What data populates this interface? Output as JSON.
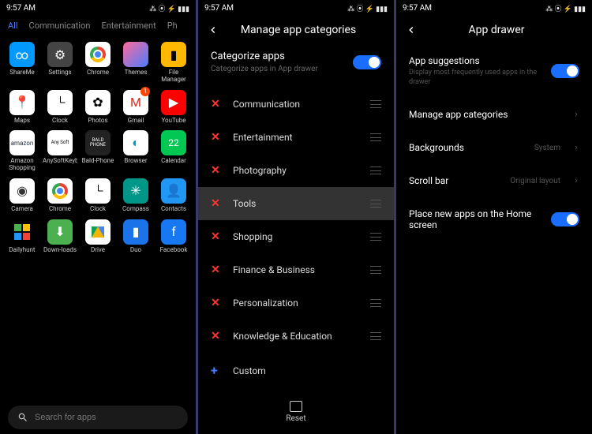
{
  "status": {
    "time": "9:57 AM",
    "icons": "⁂ ⦿ ⚡ ▮▮▮"
  },
  "drawer": {
    "tabs": [
      "All",
      "Communication",
      "Entertainment",
      "Ph"
    ],
    "apps": [
      {
        "label": "ShareMe",
        "icon": "∞",
        "cls": "ic-shareme"
      },
      {
        "label": "Settings",
        "icon": "⚙",
        "cls": "ic-settings"
      },
      {
        "label": "Chrome",
        "icon": "chrome",
        "cls": "ic-chrome"
      },
      {
        "label": "Themes",
        "icon": "",
        "cls": "ic-themes"
      },
      {
        "label": "File Manager",
        "icon": "▮",
        "cls": "ic-filemgr"
      },
      {
        "label": "Maps",
        "icon": "📍",
        "cls": "ic-maps"
      },
      {
        "label": "Clock",
        "icon": "clock",
        "cls": "ic-clock"
      },
      {
        "label": "Photos",
        "icon": "✿",
        "cls": "ic-photos"
      },
      {
        "label": "Gmail",
        "icon": "M",
        "cls": "ic-gmail",
        "badge": "1"
      },
      {
        "label": "YouTube",
        "icon": "▶",
        "cls": "ic-youtube"
      },
      {
        "label": "Amazon Shopping",
        "icon": "amazon",
        "cls": "ic-amazon"
      },
      {
        "label": "AnySoftKeyboa...",
        "icon": "Any Soft",
        "cls": "ic-anysoft"
      },
      {
        "label": "Bald-Phone",
        "icon": "BALD PHONE",
        "cls": "ic-bald"
      },
      {
        "label": "Browser",
        "icon": "◐",
        "cls": "ic-browser"
      },
      {
        "label": "Calendar",
        "icon": "22",
        "cls": "ic-calendar"
      },
      {
        "label": "Camera",
        "icon": "◉",
        "cls": "ic-camera"
      },
      {
        "label": "Chrome",
        "icon": "chrome",
        "cls": "ic-chrome2"
      },
      {
        "label": "Clock",
        "icon": "clock",
        "cls": "ic-clock2"
      },
      {
        "label": "Compass",
        "icon": "✳",
        "cls": "ic-compass"
      },
      {
        "label": "Contacts",
        "icon": "👤",
        "cls": "ic-contacts"
      },
      {
        "label": "Dailyhunt",
        "icon": "dailyhunt",
        "cls": "ic-dailyhunt"
      },
      {
        "label": "Down-loads",
        "icon": "⬇",
        "cls": "ic-downloads"
      },
      {
        "label": "Drive",
        "icon": "drive",
        "cls": "ic-drive"
      },
      {
        "label": "Duo",
        "icon": "▮",
        "cls": "ic-duo"
      },
      {
        "label": "Facebook",
        "icon": "f",
        "cls": "ic-facebook"
      }
    ],
    "search_placeholder": "Search for apps"
  },
  "manage": {
    "title": "Manage app categories",
    "toggle_title": "Categorize apps",
    "toggle_sub": "Categorize apps in App drawer",
    "categories": [
      {
        "name": "Communication",
        "highlighted": false
      },
      {
        "name": "Entertainment",
        "highlighted": false
      },
      {
        "name": "Photography",
        "highlighted": false
      },
      {
        "name": "Tools",
        "highlighted": true
      },
      {
        "name": "Shopping",
        "highlighted": false
      },
      {
        "name": "Finance & Business",
        "highlighted": false
      },
      {
        "name": "Personalization",
        "highlighted": false
      },
      {
        "name": "Knowledge & Education",
        "highlighted": false
      }
    ],
    "custom_label": "Custom",
    "reset_label": "Reset"
  },
  "settings": {
    "title": "App drawer",
    "rows": [
      {
        "title": "App suggestions",
        "sub": "Display most frequently used apps in the drawer",
        "type": "toggle"
      },
      {
        "title": "Manage app categories",
        "type": "chevron"
      },
      {
        "title": "Backgrounds",
        "value": "System",
        "type": "value"
      },
      {
        "title": "Scroll bar",
        "value": "Original layout",
        "type": "value"
      },
      {
        "title": "Place new apps on the Home screen",
        "type": "toggle"
      }
    ]
  }
}
